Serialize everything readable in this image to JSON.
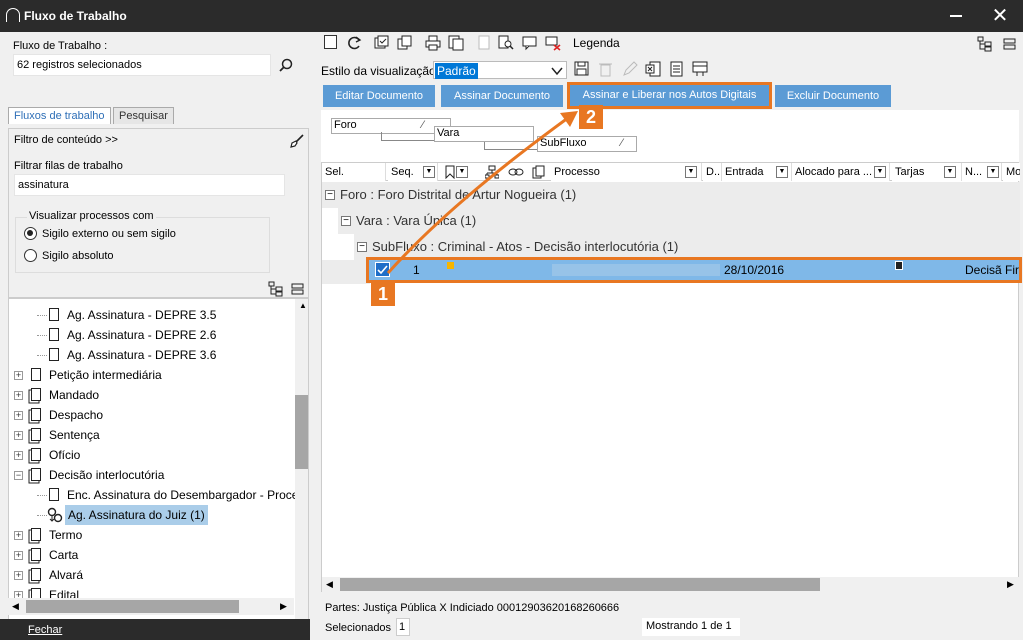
{
  "window": {
    "title": "Fluxo de Trabalho",
    "minimize": "—",
    "close": "✕"
  },
  "left": {
    "fluxo_label": "Fluxo de Trabalho :",
    "fluxo_value": "62 registros selecionados",
    "tabs": [
      "Fluxos de trabalho",
      "Pesquisar"
    ],
    "filtro_conteudo": "Filtro de conteúdo >>",
    "filtrar_label": "Filtrar filas de trabalho",
    "filtrar_value": "assinatura",
    "visualizar_label": "Visualizar processos com",
    "radio1": "Sigilo externo ou sem sigilo",
    "radio2": "Sigilo absoluto",
    "tree": [
      {
        "label": "Ag. Assinatura - DEPRE 3.5",
        "level": 2
      },
      {
        "label": "Ag. Assinatura - DEPRE 2.6",
        "level": 2
      },
      {
        "label": "Ag. Assinatura - DEPRE 3.6",
        "level": 2
      },
      {
        "label": "Petição intermediária",
        "level": 1
      },
      {
        "label": "Mandado",
        "level": 1
      },
      {
        "label": "Despacho",
        "level": 1
      },
      {
        "label": "Sentença",
        "level": 1
      },
      {
        "label": "Ofício",
        "level": 1
      },
      {
        "label": "Decisão interlocutória",
        "level": 1
      },
      {
        "label": "Enc. Assinatura do Desembargador - Proce",
        "level": 2
      },
      {
        "label": "Ag. Assinatura do Juiz (1)",
        "level": 2
      },
      {
        "label": "Termo",
        "level": 1
      },
      {
        "label": "Carta",
        "level": 1
      },
      {
        "label": "Alvará",
        "level": 1
      },
      {
        "label": "Edital",
        "level": 1
      }
    ],
    "fechar": "Fechar"
  },
  "toolbar": {
    "legenda": "Legenda",
    "estilo_label": "Estilo da visualização",
    "estilo_value": "Padrão"
  },
  "buttons": {
    "editar": "Editar Documento",
    "assinar": "Assinar Documento",
    "assinar_liberar": "Assinar e Liberar nos Autos Digitais",
    "excluir": "Excluir Documento"
  },
  "grouping": {
    "foro": "Foro",
    "vara": "Vara",
    "subfluxo": "SubFluxo"
  },
  "columns": {
    "sel": "Sel.",
    "seq": "Seq.",
    "processo": "Processo",
    "d": "D...",
    "entrada": "Entrada",
    "alocado": "Alocado para ...",
    "tarjas": "Tarjas",
    "n": "N...",
    "mo": "Mo"
  },
  "groups": {
    "foro": "Foro : Foro Distrital de Artur Nogueira  (1)",
    "vara": "Vara : Vara Única  (1)",
    "subfluxo": "SubFluxo : Criminal - Atos - Decisão interlocutória  (1)"
  },
  "row": {
    "seq": "1",
    "entrada": "28/10/2016",
    "tipo": "Decisã Fir"
  },
  "badges": {
    "one": "1",
    "two": "2"
  },
  "status": {
    "partes": "Partes: Justiça Pública  X  Indiciado 00012903620168260666",
    "selecionados_label": "Selecionados",
    "selecionados_value": "1",
    "mostrando": "Mostrando 1 de 1"
  }
}
